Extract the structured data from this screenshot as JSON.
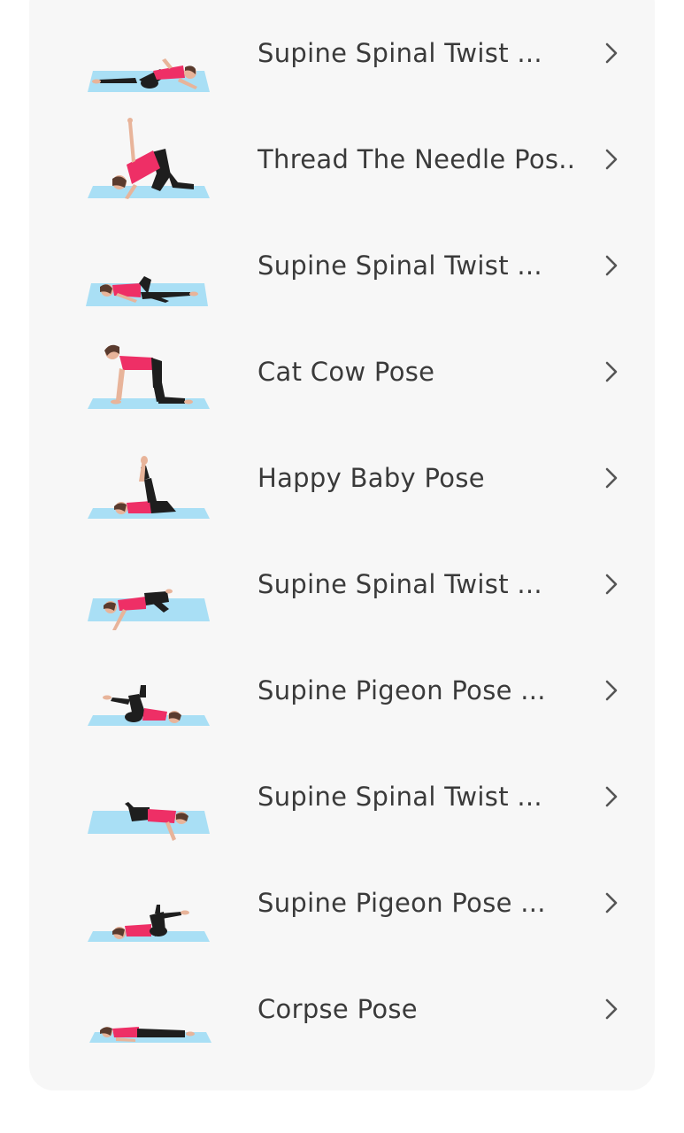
{
  "exercises": [
    {
      "label": "Supine Spinal Twist ...",
      "pose": "twist-right",
      "icon": "yoga-pose-illustration"
    },
    {
      "label": "Thread The Needle Pos...",
      "pose": "thread-needle",
      "icon": "yoga-pose-illustration"
    },
    {
      "label": "Supine Spinal Twist ...",
      "pose": "twist-left",
      "icon": "yoga-pose-illustration"
    },
    {
      "label": "Cat Cow Pose",
      "pose": "cat-cow",
      "icon": "yoga-pose-illustration"
    },
    {
      "label": "Happy Baby Pose",
      "pose": "happy-baby",
      "icon": "yoga-pose-illustration"
    },
    {
      "label": "Supine Spinal Twist ...",
      "pose": "twist-arm-down",
      "icon": "yoga-pose-illustration"
    },
    {
      "label": "Supine Pigeon Pose ...",
      "pose": "pigeon-left",
      "icon": "yoga-pose-illustration"
    },
    {
      "label": "Supine Spinal Twist ...",
      "pose": "twist-arm-down-right",
      "icon": "yoga-pose-illustration"
    },
    {
      "label": "Supine Pigeon Pose ...",
      "pose": "pigeon-right",
      "icon": "yoga-pose-illustration"
    },
    {
      "label": "Corpse Pose",
      "pose": "corpse",
      "icon": "yoga-pose-illustration"
    }
  ],
  "colors": {
    "card_background": "#f7f7f7",
    "mat": "#a9dff5",
    "shirt": "#ee2f66",
    "pants": "#1e1e1e",
    "skin": "#e8b49a",
    "hair": "#5a3b2e",
    "text": "#3a3a3a",
    "chevron": "#555555"
  },
  "chevron_icon": "chevron-right-icon"
}
